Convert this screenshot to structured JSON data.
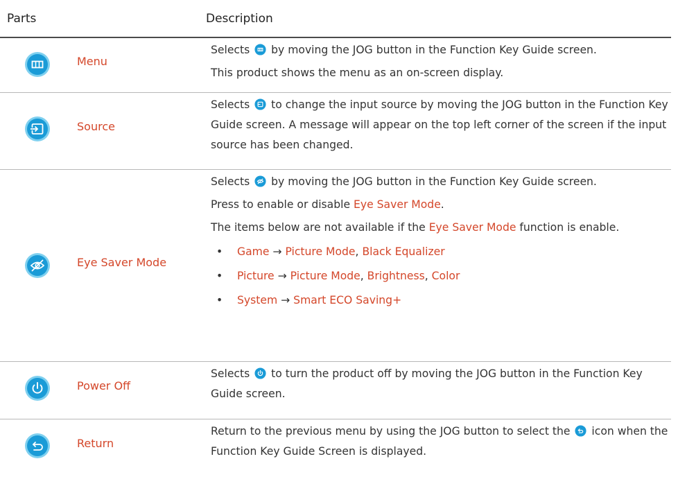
{
  "table": {
    "col_parts": "Parts",
    "col_description": "Description"
  },
  "rows": [
    {
      "part": "Menu",
      "icon": "menu-icon",
      "lines": [
        [
          "Selects ",
          " by moving the JOG button in the Function Key Guide screen."
        ],
        "This product shows the menu as an on-screen display."
      ]
    },
    {
      "part": "Source",
      "icon": "source-icon",
      "lines": [
        [
          "Selects ",
          " to change the input source by moving the JOG button in the Function Key Guide screen. A message will appear on the top left corner of the screen if the input source has been changed."
        ]
      ]
    },
    {
      "part": "Eye Saver Mode",
      "icon": "eye-saver-icon",
      "lines": [
        [
          "Selects ",
          " by moving the JOG button in the Function Key Guide screen."
        ],
        [
          "Press to enable or disable ",
          "Eye Saver Mode",
          "."
        ],
        [
          "The items below are not available if the ",
          "Eye Saver Mode",
          " function is enable."
        ]
      ],
      "bullets": [
        {
          "menu": "Game",
          "arrow": "→",
          "items": [
            "Picture Mode",
            "Black Equalizer"
          ]
        },
        {
          "menu": "Picture",
          "arrow": "→",
          "items": [
            "Picture Mode",
            "Brightness",
            "Color"
          ]
        },
        {
          "menu": "System",
          "arrow": "→",
          "items": [
            "Smart ECO Saving+"
          ]
        }
      ]
    },
    {
      "part": "Power Off",
      "icon": "power-icon",
      "lines": [
        [
          "Selects ",
          " to turn the product off by moving the JOG button in the Function Key Guide screen."
        ]
      ]
    },
    {
      "part": "Return",
      "icon": "return-icon",
      "lines": [
        [
          "Return to the previous menu by using the JOG button to select the ",
          " icon when the Function Key Guide Screen is displayed."
        ]
      ]
    }
  ],
  "colors": {
    "accent": "#d4472a",
    "icon_fill": "#1a9bd7",
    "icon_ring": "#7fd0ef"
  }
}
